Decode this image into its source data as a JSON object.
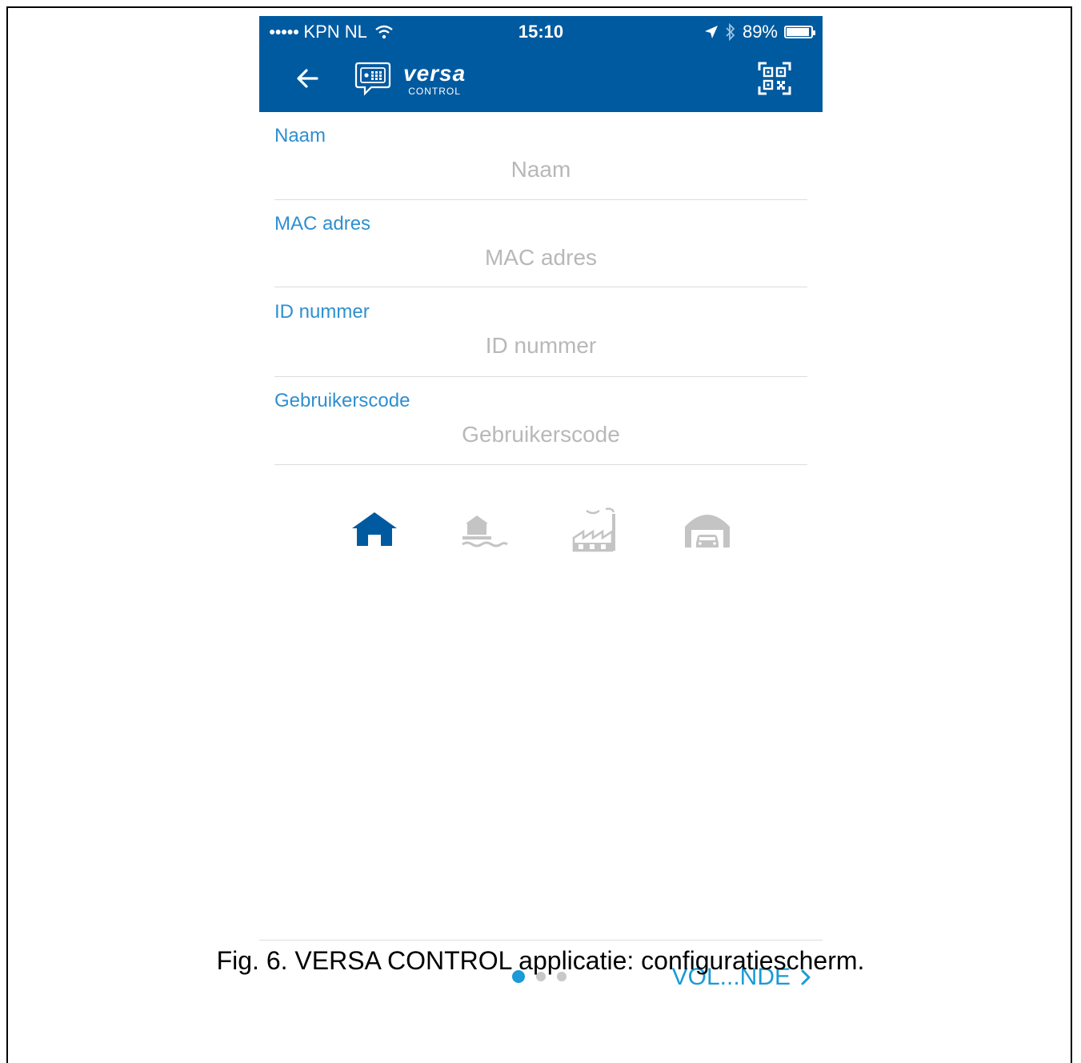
{
  "status_bar": {
    "carrier": "KPN NL",
    "time": "15:10",
    "battery": "89%",
    "battery_level": 0.89
  },
  "header": {
    "logo_title": "versa",
    "logo_subtitle": "CONTROL",
    "brand_color": "#005aa0",
    "icons": [
      "back-arrow-icon",
      "keypad-icon",
      "qr-code-icon"
    ]
  },
  "form": {
    "fields": [
      {
        "label": "Naam",
        "placeholder": "Naam",
        "value": ""
      },
      {
        "label": "MAC adres",
        "placeholder": "MAC adres",
        "value": ""
      },
      {
        "label": "ID nummer",
        "placeholder": "ID nummer",
        "value": ""
      },
      {
        "label": "Gebruikerscode",
        "placeholder": "Gebruikerscode",
        "value": ""
      }
    ],
    "label_color": "#2f8fd0"
  },
  "property_types": [
    {
      "icon": "house-icon",
      "selected": true
    },
    {
      "icon": "lakeside-house-icon",
      "selected": false
    },
    {
      "icon": "factory-icon",
      "selected": false
    },
    {
      "icon": "garage-icon",
      "selected": false
    }
  ],
  "footer": {
    "page_count": 3,
    "current_page": 1,
    "next_label": "VOL...NDE"
  },
  "caption": "Fig. 6. VERSA CONTROL applicatie: configuratiescherm."
}
